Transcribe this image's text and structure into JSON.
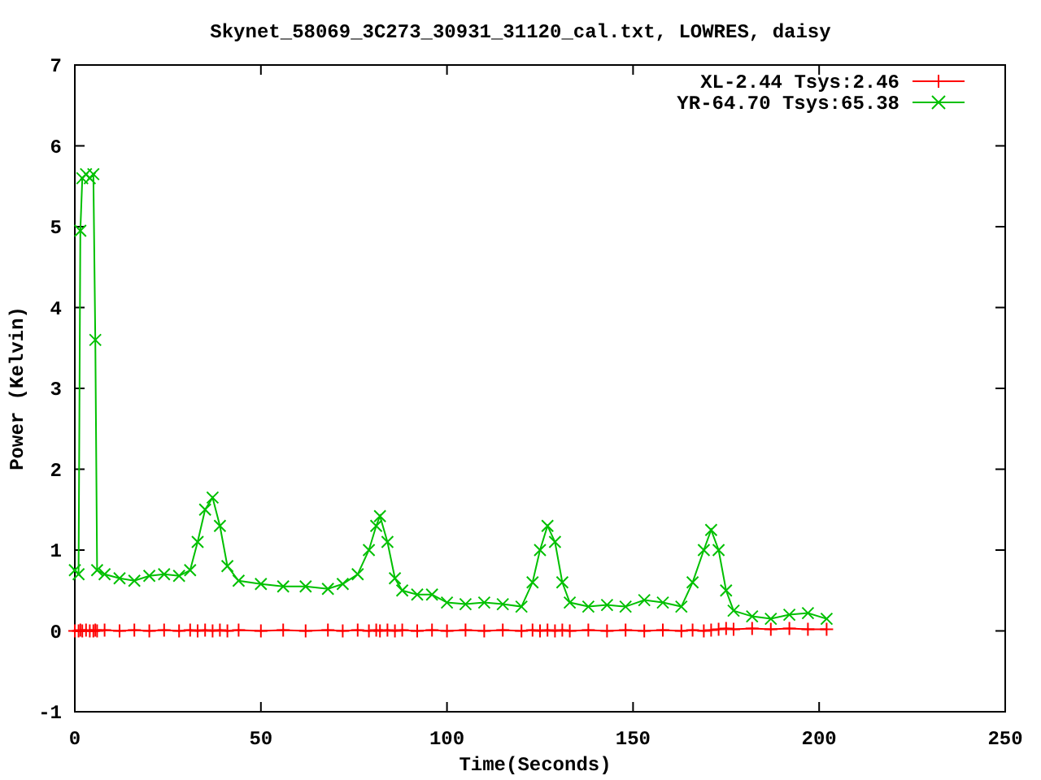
{
  "chart_data": {
    "type": "line",
    "title": "Skynet_58069_3C273_30931_31120_cal.txt, LOWRES, daisy",
    "xlabel": "Time(Seconds)",
    "ylabel": "Power (Kelvin)",
    "x": [
      0,
      1,
      1.5,
      2,
      3,
      4,
      5,
      5.5,
      6,
      8,
      12,
      16,
      20,
      24,
      28,
      31,
      33,
      35,
      37,
      39,
      41,
      44,
      50,
      56,
      62,
      68,
      72,
      76,
      79,
      81,
      82,
      84,
      86,
      88,
      92,
      96,
      100,
      105,
      110,
      115,
      120,
      123,
      125,
      127,
      129,
      131,
      133,
      138,
      143,
      148,
      153,
      158,
      163,
      166,
      169,
      171,
      173,
      175,
      177,
      182,
      187,
      192,
      197,
      202
    ],
    "series": [
      {
        "name": "XL-2.44 Tsys:2.46",
        "color": "#ff0000",
        "values": [
          0,
          0,
          0.01,
          0,
          0.01,
          0,
          0,
          0.01,
          0,
          0.01,
          0,
          0.01,
          0,
          0.01,
          0,
          0.01,
          0,
          0.01,
          0,
          0.01,
          0,
          0.01,
          0,
          0.01,
          0,
          0.01,
          0,
          0.01,
          0,
          0.01,
          0,
          0.01,
          0,
          0.01,
          0,
          0.01,
          0,
          0.01,
          0,
          0.01,
          0,
          0.01,
          0,
          0.01,
          0,
          0.01,
          0,
          0.01,
          0,
          0.01,
          0,
          0.01,
          0,
          0.01,
          0,
          0.01,
          0.02,
          0.03,
          0.02,
          0.03,
          0.02,
          0.03,
          0.02,
          0.02
        ]
      },
      {
        "name": "YR-64.70 Tsys:65.38",
        "color": "#00c000",
        "values": [
          0.75,
          0.7,
          4.95,
          5.6,
          5.65,
          5.6,
          5.65,
          3.6,
          0.75,
          0.7,
          0.65,
          0.62,
          0.68,
          0.7,
          0.68,
          0.75,
          1.1,
          1.5,
          1.65,
          1.3,
          0.8,
          0.62,
          0.58,
          0.55,
          0.55,
          0.52,
          0.58,
          0.7,
          1.0,
          1.3,
          1.42,
          1.1,
          0.65,
          0.5,
          0.45,
          0.45,
          0.35,
          0.33,
          0.35,
          0.33,
          0.3,
          0.6,
          1.0,
          1.3,
          1.1,
          0.6,
          0.35,
          0.3,
          0.32,
          0.3,
          0.38,
          0.35,
          0.3,
          0.6,
          1.0,
          1.25,
          1.0,
          0.5,
          0.25,
          0.18,
          0.15,
          0.2,
          0.22,
          0.15
        ]
      }
    ],
    "legend": true,
    "xlim": [
      0,
      250
    ],
    "ylim": [
      -1,
      7
    ],
    "xticks": [
      0,
      50,
      100,
      150,
      200,
      250
    ],
    "yticks": [
      -1,
      0,
      1,
      2,
      3,
      4,
      5,
      6,
      7
    ]
  }
}
